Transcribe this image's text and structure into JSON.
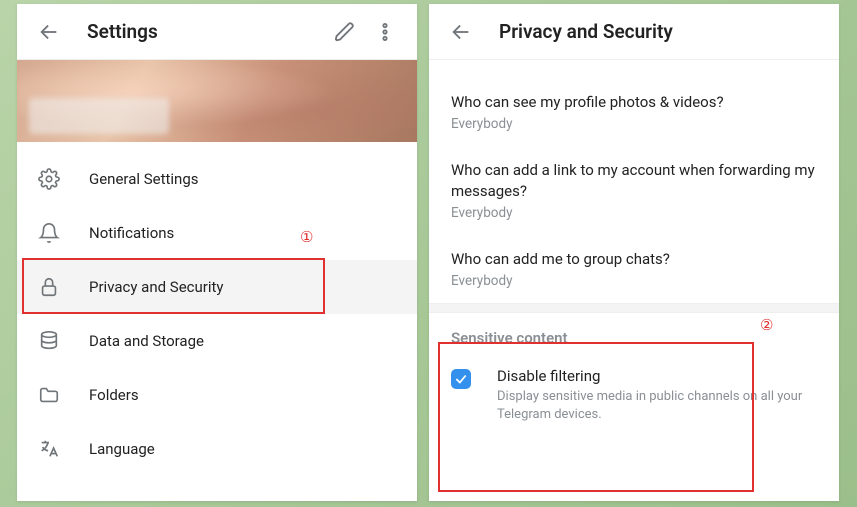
{
  "settings": {
    "header": {
      "title": "Settings"
    },
    "menu": [
      {
        "key": "general",
        "label": "General Settings"
      },
      {
        "key": "notifications",
        "label": "Notifications"
      },
      {
        "key": "privacy",
        "label": "Privacy and Security",
        "active": true
      },
      {
        "key": "data",
        "label": "Data and Storage"
      },
      {
        "key": "folders",
        "label": "Folders"
      },
      {
        "key": "language",
        "label": "Language"
      }
    ]
  },
  "privacy": {
    "header": {
      "title": "Privacy and Security"
    },
    "rows": [
      {
        "title": "Who can see my profile photos & videos?",
        "value": "Everybody"
      },
      {
        "title": "Who can add a link to my account when forwarding my messages?",
        "value": "Everybody"
      },
      {
        "title": "Who can add me to group chats?",
        "value": "Everybody"
      }
    ],
    "sensitive": {
      "section_label": "Sensitive content",
      "toggle": {
        "title": "Disable filtering",
        "desc": "Display sensitive media in public channels on all your Telegram devices.",
        "checked": true
      }
    }
  },
  "annotations": {
    "one": "①",
    "two": "②"
  }
}
